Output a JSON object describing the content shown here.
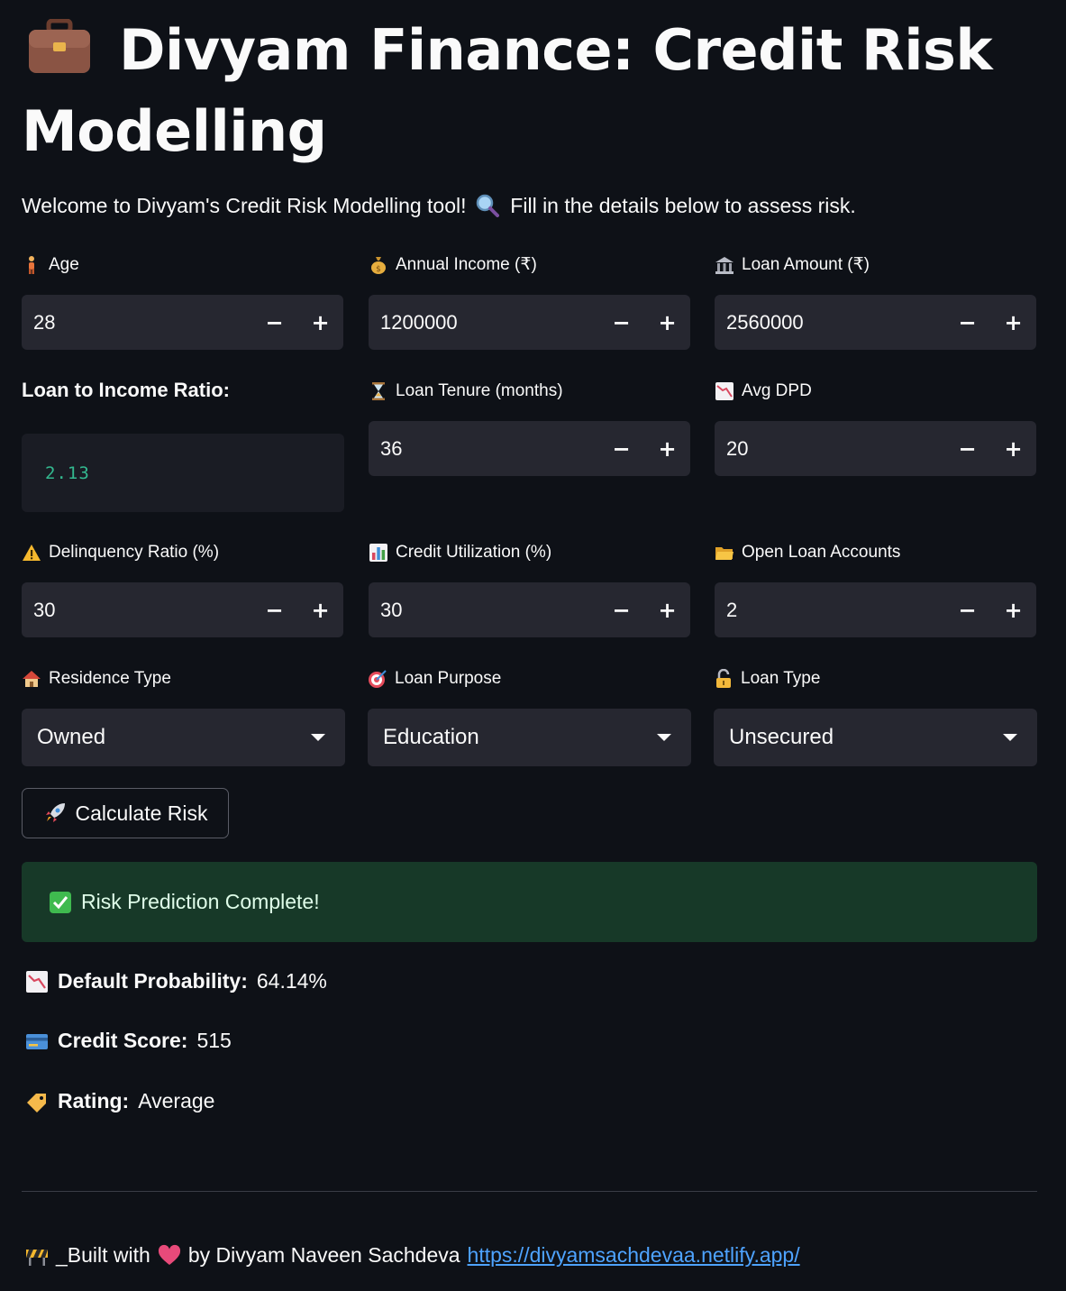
{
  "header": {
    "title_line1": "Divyam Finance: Credit Risk",
    "title_line2": "Modelling",
    "welcome_part1": "Welcome to Divyam's Credit Risk Modelling tool!",
    "welcome_part2": "Fill in the details below to assess risk."
  },
  "inputs": {
    "age": {
      "label": "Age",
      "value": "28"
    },
    "annual_income": {
      "label": "Annual Income (₹)",
      "value": "1200000"
    },
    "loan_amount": {
      "label": "Loan Amount (₹)",
      "value": "2560000"
    },
    "loan_tenure": {
      "label": "Loan Tenure (months)",
      "value": "36"
    },
    "avg_dpd": {
      "label": "Avg DPD",
      "value": "20"
    },
    "delinquency_ratio": {
      "label": "Delinquency Ratio (%)",
      "value": "30"
    },
    "credit_utilization": {
      "label": "Credit Utilization (%)",
      "value": "30"
    },
    "open_loan_accounts": {
      "label": "Open Loan Accounts",
      "value": "2"
    }
  },
  "selects": {
    "residence_type": {
      "label": "Residence Type",
      "value": "Owned"
    },
    "loan_purpose": {
      "label": "Loan Purpose",
      "value": "Education"
    },
    "loan_type": {
      "label": "Loan Type",
      "value": "Unsecured"
    }
  },
  "ratio": {
    "label": "Loan to Income Ratio:",
    "value": "2.13"
  },
  "stepper": {
    "minus": "−",
    "plus": "+"
  },
  "calculate_button": {
    "label": "Calculate Risk"
  },
  "success_message": "Risk Prediction Complete!",
  "results": {
    "default_probability": {
      "label": "Default Probability:",
      "value": "64.14%"
    },
    "credit_score": {
      "label": "Credit Score:",
      "value": "515"
    },
    "rating": {
      "label": "Rating:",
      "value": "Average"
    }
  },
  "footer": {
    "text_part1": "_Built with",
    "text_part2": "by Divyam Naveen Sachdeva",
    "link_text": "https://divyamsachdevaa.netlify.app/"
  },
  "colors": {
    "background": "#0e1117",
    "input_bg": "#262730",
    "success_bg": "#173928",
    "ratio_text": "#33b88f",
    "link": "#4ea3ff"
  }
}
